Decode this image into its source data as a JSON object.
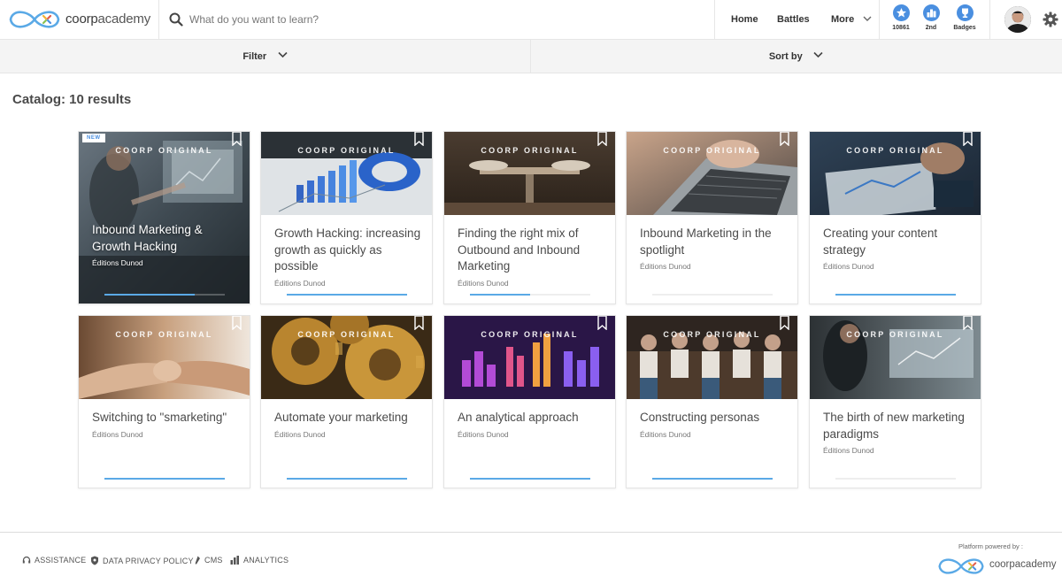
{
  "header": {
    "logo_text_bold": "coorp",
    "logo_text_light": "academy",
    "search_placeholder": "What do you want to learn?",
    "nav": {
      "home": "Home",
      "battles": "Battles",
      "more": "More"
    },
    "stats": [
      {
        "label": "10861",
        "icon": "star-icon"
      },
      {
        "label": "2nd",
        "icon": "ranking-icon"
      },
      {
        "label": "Badges",
        "icon": "trophy-icon"
      }
    ],
    "accent_color": "#4a8fe0"
  },
  "filterbar": {
    "filter_label": "Filter",
    "sort_label": "Sort by"
  },
  "catalog": {
    "title": "Catalog: 10 results",
    "original_label": "COORP ORIGINAL",
    "new_badge": "NEW",
    "courses": [
      {
        "title": "Inbound Marketing & Growth Hacking",
        "publisher": "Éditions Dunod",
        "progress": 0.75
      },
      {
        "title": "Growth Hacking: increasing growth as quickly as possible",
        "publisher": "Éditions Dunod",
        "progress": 0.75
      },
      {
        "title": "Finding the right mix of Outbound and Inbound Marketing",
        "publisher": "Éditions Dunod",
        "progress": 0.5
      },
      {
        "title": "Inbound Marketing in the spotlight",
        "publisher": "Éditions Dunod",
        "progress": 0
      },
      {
        "title": "Creating your content strategy",
        "publisher": "Éditions Dunod",
        "progress": 1
      },
      {
        "title": "Switching to \"smarketing\"",
        "publisher": "Éditions Dunod",
        "progress": 1
      },
      {
        "title": "Automate your marketing",
        "publisher": "Éditions Dunod",
        "progress": 1
      },
      {
        "title": "An analytical approach",
        "publisher": "Éditions Dunod",
        "progress": 1
      },
      {
        "title": "Constructing personas",
        "publisher": "Éditions Dunod",
        "progress": 1
      },
      {
        "title": "The birth of new marketing paradigms",
        "publisher": "Éditions Dunod",
        "progress": 0
      }
    ]
  },
  "footer": {
    "links": [
      "ASSISTANCE",
      "DATA PRIVACY POLICY",
      "CMS",
      "ANALYTICS"
    ],
    "powered_by": "Platform powered by :",
    "logo_text_bold": "coorp",
    "logo_text_light": "academy"
  }
}
